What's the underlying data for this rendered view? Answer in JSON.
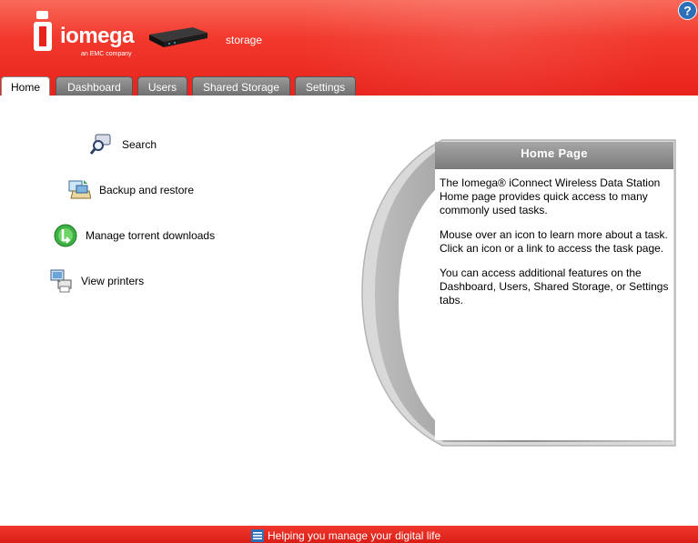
{
  "header": {
    "brand": "iomega",
    "brand_sub": "an EMC company",
    "device_label": "storage",
    "help_icon": "help-icon"
  },
  "tabs": [
    {
      "label": "Home",
      "active": true
    },
    {
      "label": "Dashboard",
      "active": false
    },
    {
      "label": "Users",
      "active": false
    },
    {
      "label": "Shared Storage",
      "active": false
    },
    {
      "label": "Settings",
      "active": false
    }
  ],
  "tasks": [
    {
      "label": "Search",
      "icon": "search-icon"
    },
    {
      "label": "Backup and restore",
      "icon": "backup-icon"
    },
    {
      "label": "Manage torrent downloads",
      "icon": "torrent-icon"
    },
    {
      "label": "View printers",
      "icon": "printer-icon"
    }
  ],
  "panel": {
    "title": "Home Page",
    "paragraphs": [
      "The Iomega® iConnect Wireless Data Station Home page provides quick access to many commonly used tasks.",
      "Mouse over an icon to learn more about a task. Click an icon or a link to access the task page.",
      "You can access additional features on the Dashboard, Users, Shared Storage, or Settings tabs."
    ]
  },
  "footer": {
    "text": "Helping you manage your digital life"
  },
  "colors": {
    "brand_red": "#e8231c",
    "tab_gray": "#7a7a7a",
    "panel_title": "#8a8a8a"
  }
}
